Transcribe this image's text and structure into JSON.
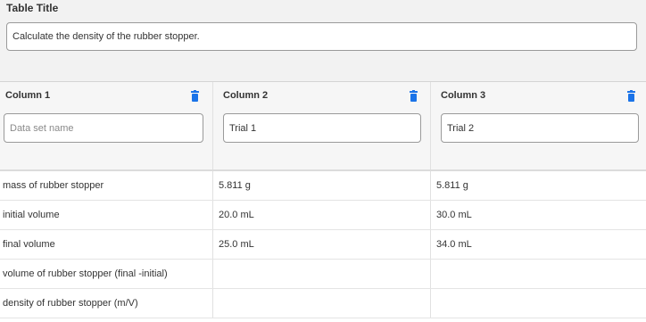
{
  "table": {
    "title_label": "Table Title",
    "title_value": "Calculate the density of the rubber stopper."
  },
  "columns": [
    {
      "label": "Column 1",
      "input_value": "",
      "input_placeholder": "Data set name",
      "delete_icon": "trash-icon"
    },
    {
      "label": "Column 2",
      "input_value": "Trial 1",
      "input_placeholder": "",
      "delete_icon": "trash-icon"
    },
    {
      "label": "Column 3",
      "input_value": "Trial 2",
      "input_placeholder": "",
      "delete_icon": "trash-icon"
    }
  ],
  "rows": [
    {
      "label": "mass of rubber stopper",
      "values": [
        "5.811 g",
        "5.811 g"
      ]
    },
    {
      "label": "initial volume",
      "values": [
        "20.0 mL",
        "30.0 mL"
      ]
    },
    {
      "label": "final volume",
      "values": [
        "25.0 mL",
        "34.0 mL"
      ]
    },
    {
      "label": "volume of rubber stopper (final -initial)",
      "values": [
        "",
        ""
      ]
    },
    {
      "label": "density of rubber stopper (m/V)",
      "values": [
        "",
        ""
      ]
    }
  ],
  "colors": {
    "accent": "#1a73e8",
    "header_bg": "#f6f6f6",
    "border": "#9a9a9a"
  }
}
